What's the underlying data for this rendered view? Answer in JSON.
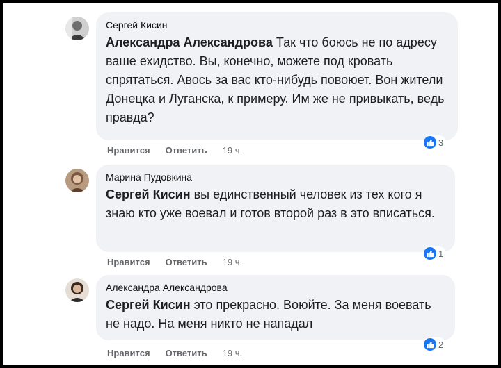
{
  "comments": [
    {
      "author": "Сергей Кисин",
      "mention": "Александра Александрова",
      "text": " Так что боюсь не по адресу ваше ехидство. Вы, конечно, можете под кровать спрятаться. Авось за вас кто-нибудь повоюет. Вон жители Донецка и Луганска, к примеру. Им же не привыкать, ведь правда?",
      "like_label": "Нравится",
      "reply_label": "Ответить",
      "time": "19 ч.",
      "reaction_count": "3",
      "avatar": "avatar-man-icon"
    },
    {
      "author": "Марина Пудовкина",
      "mention": "Сергей Кисин",
      "text": " вы единственный человек из тех кого я знаю кто уже воевал и готов второй раз в это вписаться.",
      "like_label": "Нравится",
      "reply_label": "Ответить",
      "time": "19 ч.",
      "reaction_count": "1",
      "avatar": "avatar-woman-icon"
    },
    {
      "author": "Александра Александрова",
      "mention": "Сергей Кисин",
      "text": " это прекрасно. Воюйте. За меня воевать не надо. На меня никто не нападал",
      "like_label": "Нравится",
      "reply_label": "Ответить",
      "time": "19 ч.",
      "reaction_count": "2",
      "avatar": "avatar-woman-icon"
    }
  ],
  "colors": {
    "bubble": "#f0f2f5",
    "like_blue": "#1877f2",
    "meta_gray": "#65676b"
  }
}
